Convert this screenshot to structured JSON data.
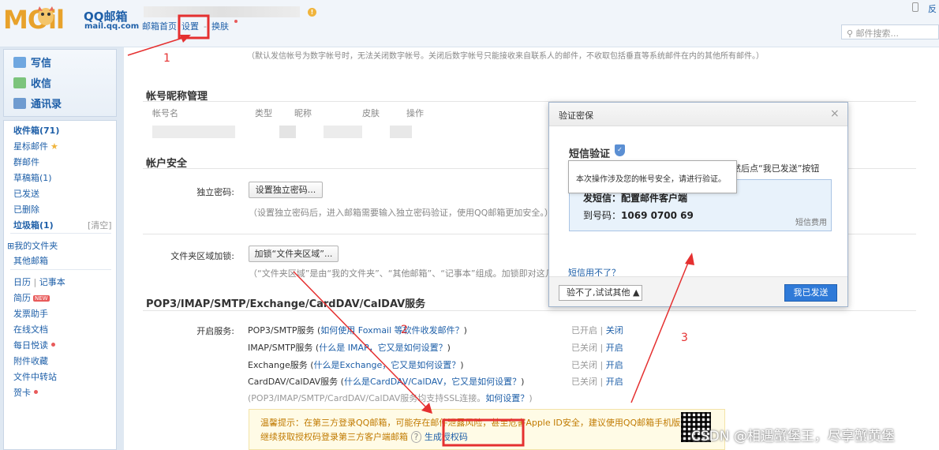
{
  "header": {
    "logo_brand": "MOil",
    "logo_title": "QQ邮箱",
    "logo_domain": "mail.qq.com",
    "nav": [
      "邮箱首页",
      "设置",
      "换肤"
    ],
    "search_placeholder": "邮件搜索...",
    "topright_text": "反"
  },
  "sidebar": {
    "quick": [
      "写信",
      "收信",
      "通讯录"
    ],
    "folders": [
      {
        "label": "收件箱(71)",
        "bold": true
      },
      {
        "label": "星标邮件",
        "star": true
      },
      {
        "label": "群邮件"
      },
      {
        "label": "草稿箱(1)"
      },
      {
        "label": "已发送"
      },
      {
        "label": "已删除"
      },
      {
        "label": "垃圾箱(1)",
        "bold": true,
        "extra": "[清空]"
      }
    ],
    "my_folders": "⊞我的文件夹",
    "other_mail": "其他邮箱",
    "tools": {
      "calendar": "日历",
      "sep": "|",
      "notes": "记事本",
      "resume": "简历",
      "resume_badge": "NEW",
      "invoice": "发票助手",
      "docs": "在线文档",
      "daily": "每日悦读",
      "attachments": "附件收藏",
      "transfer": "文件中转站",
      "cards": "贺卡"
    }
  },
  "main": {
    "top_hint": "（默认发信帐号为数字帐号时，无法关闭数字帐号。关闭后数字帐号只能接收来自联系人的邮件，不收取包括垂直等系统邮件在内的其他所有邮件。）",
    "account_section": "帐号昵称管理",
    "account_headers": [
      "帐号名",
      "类型",
      "昵称",
      "皮肤",
      "操作"
    ],
    "security_section": "帐户安全",
    "indep_pwd_label": "独立密码:",
    "indep_pwd_button": "设置独立密码...",
    "indep_pwd_hint": "（设置独立密码后，进入邮箱需要输入独立密码验证，使用QQ邮箱更加安全。）",
    "lock_label": "文件夹区域加锁:",
    "lock_button": "加锁“文件夹区域”...",
    "lock_hint": "（“文件夹区域”是由“我的文件夹”、“其他邮箱”、“记事本”组成。加锁即对这几部分设",
    "pop_section": "POP3/IMAP/SMTP/Exchange/CardDAV/CalDAV服务",
    "service_label": "开启服务:",
    "services": [
      {
        "name": "POP3/SMTP服务",
        "help": "如何使用 Foxmail 等软件收发邮件？",
        "status": "已开启",
        "action": "关闭"
      },
      {
        "name": "IMAP/SMTP服务",
        "help": "什么是 IMAP，它又是如何设置？",
        "status": "已关闭",
        "action": "开启"
      },
      {
        "name": "Exchange服务",
        "help": "什么是Exchange，它又是如何设置？",
        "status": "已关闭",
        "action": "开启"
      },
      {
        "name": "CardDAV/CalDAV服务",
        "help": "什么是CardDAV/CalDAV，它又是如何设置？",
        "status": "已关闭",
        "action": "开启"
      }
    ],
    "ssl_note": "(POP3/IMAP/SMTP/CardDAV/CalDAV服务均支持SSL连接。",
    "ssl_link": "如何设置？",
    "ssl_close": ")",
    "status_sep": "|",
    "tip_line1": "温馨提示：在第三方登录QQ邮箱，可能存在邮件泄露风险，甚至危害Apple ID安全，建议使用QQ邮箱手机版登录。",
    "tip_line2": "继续获取授权码登录第三方客户端邮箱",
    "tip_q": "?",
    "tip_gen": "生成授权码"
  },
  "dialog": {
    "title": "验证密保",
    "close": "×",
    "sms_title": "短信验证",
    "shield": "✓",
    "sms_tail": "然后点“我已发送”按钮",
    "tooltip": "本次操作涉及您的帐号安全，请进行验证。",
    "send_content": "发短信：配置邮件客户端",
    "to_label": "到号码：",
    "to_number": "1069 0700 69",
    "fee": "短信费用",
    "cant_use": "短信用不了？",
    "alt_button": "验不了,试试其他",
    "send_button": "我已发送"
  },
  "annotations": {
    "n1": "1",
    "n2": "2",
    "n3": "3",
    "color": "#e53030"
  },
  "watermark": "CSDN @相遇蟹堡王，尽享蟹黄堡"
}
